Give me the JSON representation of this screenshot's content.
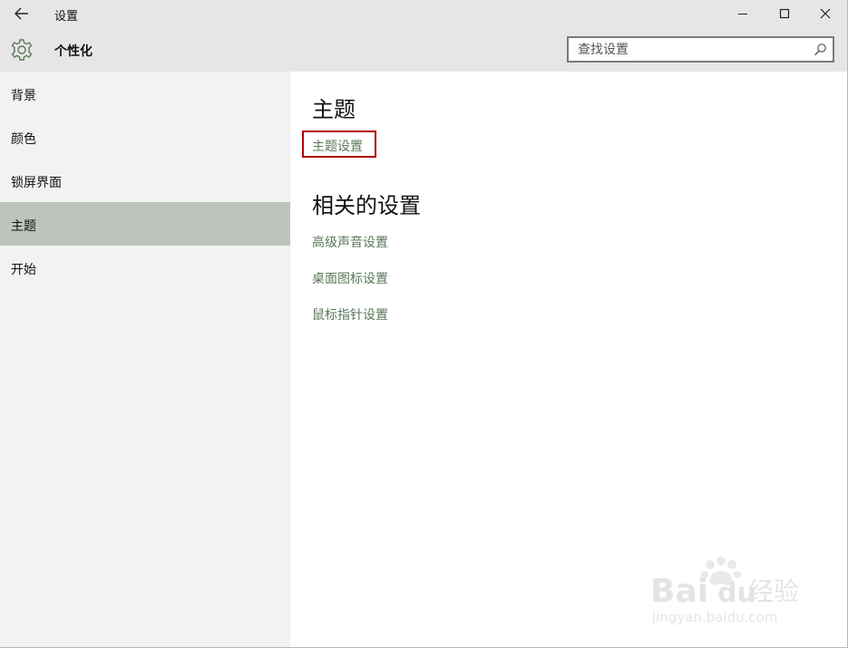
{
  "window": {
    "title": "设置",
    "controls": {
      "minimize": "minimize-icon",
      "maximize": "maximize-icon",
      "close": "close-icon"
    }
  },
  "header": {
    "page_title": "个性化",
    "icon": "gear-icon",
    "search": {
      "placeholder": "查找设置",
      "value": ""
    }
  },
  "sidebar": {
    "items": [
      {
        "label": "背景",
        "selected": false
      },
      {
        "label": "颜色",
        "selected": false
      },
      {
        "label": "锁屏界面",
        "selected": false
      },
      {
        "label": "主题",
        "selected": true
      },
      {
        "label": "开始",
        "selected": false
      }
    ]
  },
  "main": {
    "section_title": "主题",
    "theme_settings_link": "主题设置",
    "related_title": "相关的设置",
    "related_links": [
      "高级声音设置",
      "桌面图标设置",
      "鼠标指针设置"
    ]
  },
  "watermark": {
    "brand": "Bai",
    "brand_suffix": "du",
    "brand_cn": "经验",
    "url": "jingyan.baidu.com"
  },
  "colors": {
    "accent_link": "#5b775a",
    "selected_nav": "#bcc4bb",
    "highlight_border": "#b00000",
    "header_bg": "#e6e6e6",
    "sidebar_bg": "#f2f2f2"
  }
}
